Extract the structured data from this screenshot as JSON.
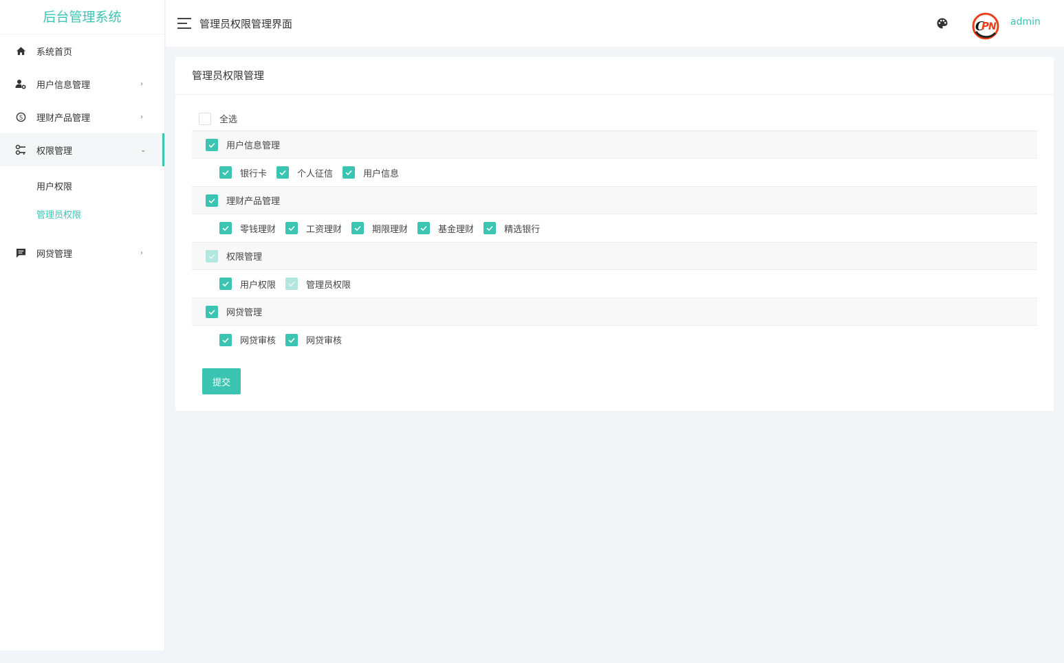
{
  "app": {
    "brand": "后台管理系统"
  },
  "header": {
    "page_title": "管理员权限管理界面",
    "username": "admin"
  },
  "sidebar": {
    "items": [
      {
        "label": "系统首页",
        "icon": "home-icon"
      },
      {
        "label": "用户信息管理",
        "icon": "user-gear-icon"
      },
      {
        "label": "理财产品管理",
        "icon": "money-circle-icon"
      },
      {
        "label": "权限管理",
        "icon": "key-icon"
      },
      {
        "label": "网贷管理",
        "icon": "message-icon"
      }
    ],
    "sub_items": [
      {
        "label": "用户权限"
      },
      {
        "label": "管理员权限"
      }
    ]
  },
  "card": {
    "title": "管理员权限管理",
    "select_all": "全选",
    "groups": [
      {
        "label": "用户信息管理",
        "children": [
          "银行卡",
          "个人征信",
          "用户信息"
        ]
      },
      {
        "label": "理财产品管理",
        "children": [
          "零钱理财",
          "工资理财",
          "期限理财",
          "基金理财",
          "精选银行"
        ]
      },
      {
        "label": "权限管理",
        "children": [
          "用户权限",
          "管理员权限"
        ]
      },
      {
        "label": "网贷管理",
        "children": [
          "网贷审核",
          "网贷审核"
        ]
      }
    ],
    "submit": "提交"
  },
  "colors": {
    "accent": "#3cc4b2",
    "disabled_check": "#b3e6df"
  }
}
